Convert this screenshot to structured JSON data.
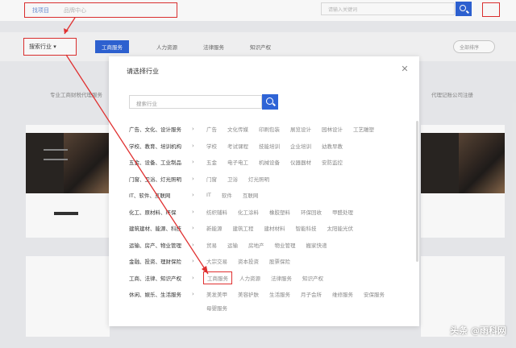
{
  "top_tabs": [
    "找项目",
    "品牌中心"
  ],
  "search_placeholder": "请输入关键词",
  "filter": {
    "industry_label": "搜索行业 ▾",
    "tabs": [
      "工商服务",
      "人力资源",
      "法律服务",
      "知识产权"
    ],
    "right_pill": "全部排序"
  },
  "bg_captions": [
    "专业工商财税代理服务",
    "代理记账公司注册"
  ],
  "modal": {
    "title": "请选择行业",
    "search_placeholder": "搜索行业",
    "categories": [
      {
        "label": "广告、文化、设计服务",
        "subs": [
          "广告",
          "文化传媒",
          "印刷包装",
          "展览设计",
          "园林设计",
          "工艺雕塑"
        ]
      },
      {
        "label": "学校、教育、培训机构",
        "subs": [
          "学校",
          "考试课程",
          "技能培训",
          "企业培训",
          "幼教早教"
        ]
      },
      {
        "label": "五金、设备、工业制品",
        "subs": [
          "五金",
          "电子电工",
          "机械设备",
          "仪器器材",
          "安防监控"
        ]
      },
      {
        "label": "门窗、卫浴、灯光照明",
        "subs": [
          "门窗",
          "卫浴",
          "灯光照明"
        ]
      },
      {
        "label": "IT、软件、互联网",
        "subs": [
          "IT",
          "软件",
          "互联网"
        ]
      },
      {
        "label": "化工、原材料、环保",
        "subs": [
          "纺织辅料",
          "化工涂料",
          "橡胶塑料",
          "环保回收",
          "甲醛处理"
        ]
      },
      {
        "label": "建筑建材、能源、科技",
        "subs": [
          "新能源",
          "建筑工程",
          "建材材料",
          "智能科技",
          "太阳能光伏"
        ]
      },
      {
        "label": "运输、房产、物业管理",
        "subs": [
          "贸易",
          "运输",
          "房地产",
          "物业管理",
          "搬家快递"
        ]
      },
      {
        "label": "金融、投资、理财保险",
        "subs": [
          "大宗交易",
          "资本投资",
          "股票保险"
        ]
      },
      {
        "label": "工商、法律、知识产权",
        "subs": [
          "工商服务",
          "人力资源",
          "法律服务",
          "知识产权"
        ]
      },
      {
        "label": "休闲、娱乐、生活服务",
        "subs": [
          "美发美甲",
          "美容护肤",
          "生活服务",
          "月子会所",
          "维修服务",
          "安保服务"
        ]
      }
    ],
    "extra_sub": "母婴服务"
  },
  "watermark": "头条 @雨科网",
  "colors": {
    "accent": "#2f64d6",
    "annotation": "#e03030"
  }
}
